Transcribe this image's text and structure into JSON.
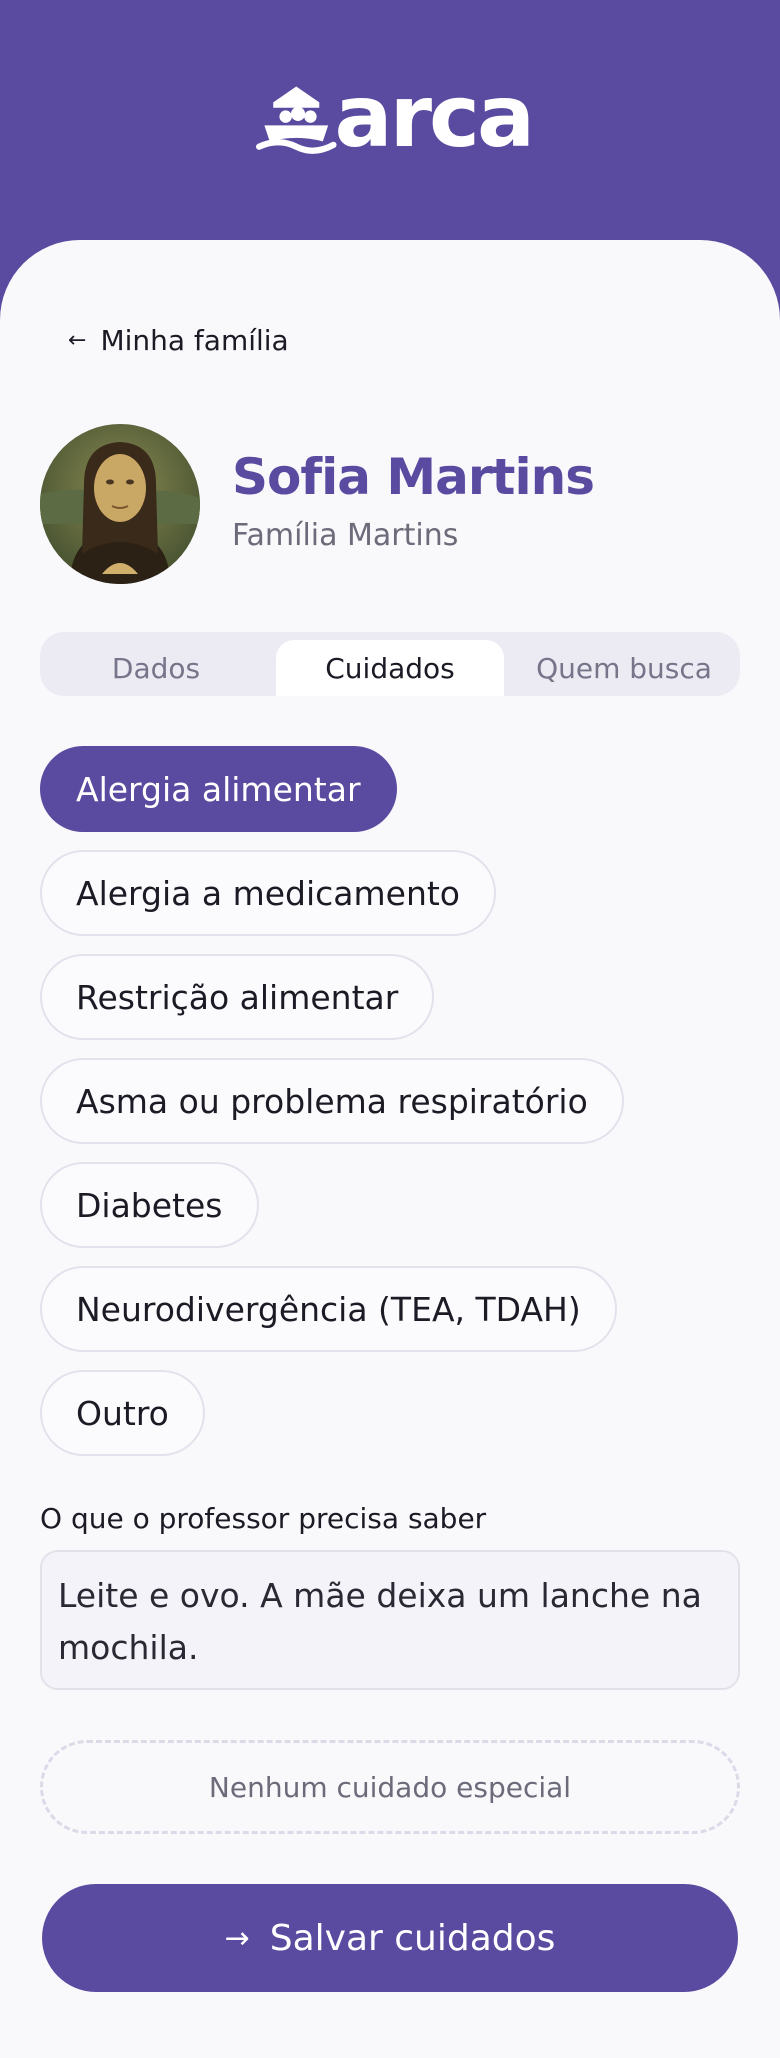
{
  "brand": {
    "name": "arca",
    "color": "#5a4ba0"
  },
  "nav": {
    "back_label": "Minha família",
    "back_icon": "arrow-left-icon"
  },
  "profile": {
    "name": "Sofia Martins",
    "family": "Família Martins",
    "avatar_icon": "child-portrait-avatar"
  },
  "tabs": [
    {
      "label": "Dados",
      "active": false
    },
    {
      "label": "Cuidados",
      "active": true
    },
    {
      "label": "Quem busca",
      "active": false
    }
  ],
  "care_options": [
    {
      "label": "Alergia alimentar",
      "selected": true
    },
    {
      "label": "Alergia a medicamento",
      "selected": false
    },
    {
      "label": "Restrição alimentar",
      "selected": false
    },
    {
      "label": "Asma ou problema respiratório",
      "selected": false
    },
    {
      "label": "Diabetes",
      "selected": false
    },
    {
      "label": "Neurodivergência (TEA, TDAH)",
      "selected": false
    },
    {
      "label": "Outro",
      "selected": false
    }
  ],
  "notes": {
    "label": "O que o professor precisa saber",
    "value": "Leite e ovo. A mãe deixa um lanche na mochila."
  },
  "none_button": {
    "label": "Nenhum cuidado especial"
  },
  "save_button": {
    "label": "Salvar cuidados",
    "icon": "arrow-right-icon"
  }
}
